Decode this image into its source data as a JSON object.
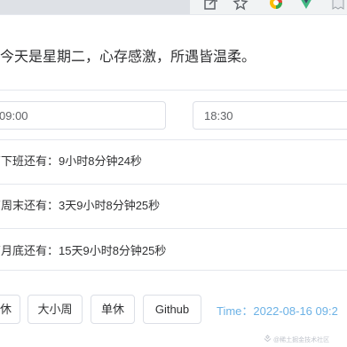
{
  "greeting": "今天是星期二，心存感激，所遇皆温柔。",
  "inputs": {
    "start_time": "09:00",
    "end_time": "18:30"
  },
  "countdowns": [
    {
      "label": "离下班还有：",
      "value": "9小时8分钟24秒"
    },
    {
      "label": "离周末还有：",
      "value": "3天9小时8分钟25秒"
    },
    {
      "label": "离月底还有：",
      "value": "15天9小时8分钟25秒"
    }
  ],
  "buttons": {
    "rest": "休",
    "big_small_week": "大小周",
    "single_rest": "单休",
    "github": "Github"
  },
  "time_display": {
    "label": "Time：",
    "value": "2022-08-16 09:2"
  },
  "watermark": "@稀土掘金技术社区",
  "toolbar_icons": [
    "share-icon",
    "star-icon",
    "color-picker-extension-icon",
    "vue-devtools-icon",
    "extension-icon"
  ],
  "colors": {
    "time_text": "#6cb2e6",
    "border": "#dcdfe6",
    "divider": "#e4e7ed"
  }
}
